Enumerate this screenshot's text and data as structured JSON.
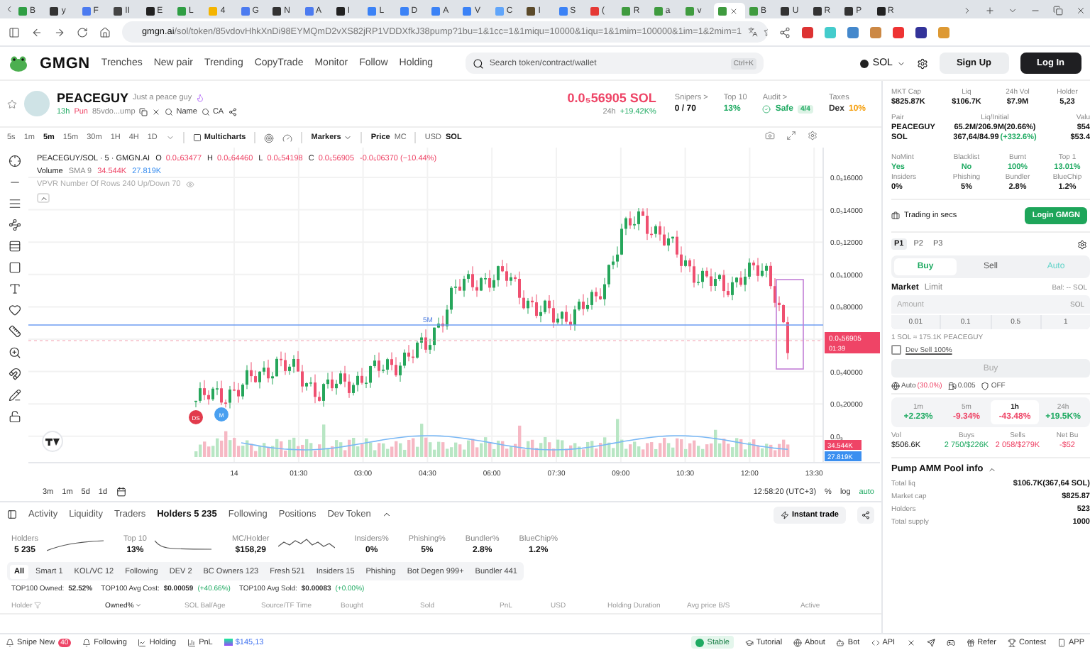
{
  "browser": {
    "tabs": [
      {
        "label": "B",
        "color": "#2f9e44",
        "selected": false
      },
      {
        "label": "y",
        "color": "#333333",
        "selected": false
      },
      {
        "label": "F",
        "color": "#4c7bf0",
        "selected": false
      },
      {
        "label": "II",
        "color": "#444444",
        "selected": false
      },
      {
        "label": "E",
        "color": "#222222",
        "selected": false
      },
      {
        "label": "L",
        "color": "#2f9e44",
        "selected": false
      },
      {
        "label": "4",
        "color": "#f4b400",
        "selected": false
      },
      {
        "label": "G",
        "color": "#4c7bf0",
        "selected": false
      },
      {
        "label": "N",
        "color": "#333333",
        "selected": false
      },
      {
        "label": "A",
        "color": "#4c7bf0",
        "selected": false
      },
      {
        "label": "I",
        "color": "#222222",
        "selected": false
      },
      {
        "label": "L",
        "color": "#3b82f6",
        "selected": false
      },
      {
        "label": "D",
        "color": "#3b82f6",
        "selected": false
      },
      {
        "label": "A",
        "color": "#3b82f6",
        "selected": false
      },
      {
        "label": "V",
        "color": "#3b82f6",
        "selected": false
      },
      {
        "label": "C",
        "color": "#60a5fa",
        "selected": false
      },
      {
        "label": "I",
        "color": "#5b4a2a",
        "selected": false
      },
      {
        "label": "S",
        "color": "#3b82f6",
        "selected": false
      },
      {
        "label": "(",
        "color": "#e53935",
        "selected": false
      },
      {
        "label": "R",
        "color": "#3f9b3f",
        "selected": false
      },
      {
        "label": "a",
        "color": "#3f9b3f",
        "selected": false
      },
      {
        "label": "v",
        "color": "#3f9b3f",
        "selected": false
      },
      {
        "color": "#3f9b3f",
        "selected": true
      },
      {
        "label": "B",
        "color": "#3f9b3f",
        "selected": false
      },
      {
        "label": "U",
        "color": "#333333",
        "selected": false
      },
      {
        "label": "R",
        "color": "#333333",
        "selected": false
      },
      {
        "label": "P",
        "color": "#333333",
        "selected": false
      },
      {
        "label": "R",
        "color": "#222222",
        "selected": false
      }
    ],
    "url_host": "gmgn.ai",
    "url_path": "/sol/token/85vdovHhkXnDi98EYMQmD2vXS82jRP1VDDXfkJ38pump?1bu=1&1cc=1&1miqu=10000&1iqu=1&1mim=100000&1im=1&2mim=1"
  },
  "header": {
    "logo": "GMGN",
    "nav": [
      "Trenches",
      "New pair",
      "Trending",
      "CopyTrade",
      "Monitor",
      "Follow",
      "Holding"
    ],
    "search": {
      "placeholder": "Search token/contract/wallet",
      "shortcut": "Ctrl+K"
    },
    "chain": "SOL",
    "sign_up": "Sign Up",
    "log_in": "Log In"
  },
  "token": {
    "name": "PEACEGUY",
    "tagline": "Just a peace guy",
    "age": "13h",
    "platform": "Pun",
    "address": "85vdo...ump",
    "links": [
      "Name",
      "CA"
    ],
    "price": "0.0₅56905 SOL",
    "change_label": "24h",
    "change": "+19.42K%",
    "stats": [
      {
        "label": "Snipers >",
        "value": "0 / 70",
        "color": "#111111"
      },
      {
        "label": "Top 10",
        "value": "13%",
        "color": "#1faa62"
      },
      {
        "label": "Audit >",
        "value": "Safe",
        "badge": "4/4",
        "color": "#1faa62"
      },
      {
        "label": "Taxes",
        "prefix": "Dex",
        "value": "10%",
        "color": "#f59e0b"
      }
    ]
  },
  "chart": {
    "intervals": [
      {
        "label": "5s",
        "selected": false
      },
      {
        "label": "1m",
        "selected": false
      },
      {
        "label": "5m",
        "selected": true
      },
      {
        "label": "15m",
        "selected": false
      },
      {
        "label": "30m",
        "selected": false
      },
      {
        "label": "1H",
        "selected": false
      },
      {
        "label": "4H",
        "selected": false
      },
      {
        "label": "1D",
        "selected": false
      }
    ],
    "multicharts": "Multicharts",
    "markers": "Markers",
    "price_mode": [
      {
        "label": "Price",
        "selected": true
      },
      {
        "label": "MC",
        "selected": false
      }
    ],
    "currency_mode": [
      {
        "label": "USD",
        "selected": false
      },
      {
        "label": "SOL",
        "selected": true
      }
    ],
    "symbol": "PEACEGUY/SOL · 5 · GMGN.AI",
    "ohlc": [
      {
        "label": "O",
        "value": "0.0₅63477"
      },
      {
        "label": "H",
        "value": "0.0₅64460"
      },
      {
        "label": "L",
        "value": "0.0₅54198"
      },
      {
        "label": "C",
        "value": "0.0₅56905"
      }
    ],
    "change": "-0.0₅06370 (−10.44%)",
    "volume_label": "Volume",
    "sma_label": "SMA 9",
    "legend_volume": [
      "34.544K",
      "27.819K"
    ],
    "axis_volume": [
      "34.544K",
      "27.819K"
    ],
    "vpvr": "VPVR Number Of Rows 240 Up/Down 70",
    "price_ticks": [
      "0.0₅16000",
      "0.0₅14000",
      "0.0₅12000",
      "0.0₅10000",
      "0.0₅80000",
      "0.0₅40000",
      "0.0₅20000",
      "0.0₅"
    ],
    "last_price": "0.0₅56905",
    "countdown": "01:39",
    "time_ticks": [
      "14",
      "01:30",
      "03:00",
      "04:30",
      "06:00",
      "07:30",
      "09:00",
      "10:30",
      "12:00",
      "13:30"
    ],
    "line_label": "5M",
    "badges": [
      "DS",
      "M"
    ],
    "ranges": [
      "3m",
      "1m",
      "5d",
      "1d"
    ],
    "clock": "12:58:20 (UTC+3)",
    "scale_options": [
      {
        "label": "%",
        "selected": false
      },
      {
        "label": "log",
        "selected": false
      },
      {
        "label": "auto",
        "selected": true
      }
    ]
  },
  "bottom": {
    "tabs": [
      {
        "label": "Activity",
        "selected": false
      },
      {
        "label": "Liquidity",
        "selected": false
      },
      {
        "label": "Traders",
        "selected": false
      },
      {
        "label": "Holders 5 235",
        "selected": true
      },
      {
        "label": "Following",
        "selected": false
      },
      {
        "label": "Positions",
        "selected": false
      },
      {
        "label": "Dev Token",
        "selected": false
      }
    ],
    "instant_trade": "Instant trade",
    "stats": [
      {
        "label": "Holders",
        "value": "5 235",
        "kind": "sparkline"
      },
      {
        "label": "Top 10",
        "value": "13%",
        "kind": "sparkline"
      },
      {
        "label": "MC/Holder",
        "value": "$158,29",
        "kind": "sparkline"
      },
      {
        "label": "Insiders%",
        "value": "0%",
        "kind": "plain"
      },
      {
        "label": "Phishing%",
        "value": "5%",
        "kind": "plain"
      },
      {
        "label": "Bundler%",
        "value": "2.8%",
        "kind": "plain"
      },
      {
        "label": "BlueChip%",
        "value": "1.2%",
        "kind": "plain"
      }
    ],
    "filters": [
      {
        "label": "All",
        "selected": true
      },
      {
        "label": "Smart 1",
        "selected": false
      },
      {
        "label": "KOL/VC 12",
        "selected": false
      },
      {
        "label": "Following",
        "selected": false
      },
      {
        "label": "DEV 2",
        "selected": false
      },
      {
        "label": "BC Owners 123",
        "selected": false
      },
      {
        "label": "Fresh 521",
        "selected": false
      },
      {
        "label": "Insiders 15",
        "selected": false
      },
      {
        "label": "Phishing",
        "selected": false
      },
      {
        "label": "Bot Degen 999+",
        "selected": false
      },
      {
        "label": "Bundler 441",
        "selected": false
      }
    ],
    "summary": [
      {
        "label": "TOP100 Owned:",
        "value": "52.52%"
      },
      {
        "label": "TOP100 Avg Cost:",
        "value": "$0.00059",
        "change": "(+40.66%)"
      },
      {
        "label": "TOP100 Avg Sold:",
        "value": "$0.00083",
        "change": "(+0.00%)"
      }
    ],
    "columns": [
      "Holder",
      "Owned%",
      "SOL Bal/Age",
      "Source/TF Time",
      "Bought",
      "Sold",
      "PnL",
      "USD",
      "Holding Duration",
      "Avg price B/S",
      "Active"
    ]
  },
  "status_bar": {
    "left": [
      {
        "label": "Snipe New",
        "badge": "40"
      },
      {
        "label": "Following"
      },
      {
        "label": "Holding"
      },
      {
        "label": "PnL"
      },
      {
        "label": "$145,13"
      }
    ],
    "right": [
      "Stable",
      "Tutorial",
      "About",
      "Bot",
      "API",
      "Refer",
      "Contest",
      "APP"
    ]
  },
  "panel": {
    "metrics": [
      {
        "label": "MKT Cap",
        "value": "$825.87K"
      },
      {
        "label": "Liq",
        "value": "$106.7K"
      },
      {
        "label": "24h Vol",
        "value": "$7.9M"
      },
      {
        "label": "Holder",
        "value": "5,23"
      }
    ],
    "pair": {
      "label": "Pair",
      "lines": [
        "PEACEGUY",
        "SOL"
      ]
    },
    "liq_initial": {
      "label": "Liq/Initial",
      "lines": [
        {
          "value": "65.2M/206.9M(20.66%)"
        },
        {
          "value": "367,64/84.99",
          "change": "(+332.6%)"
        }
      ]
    },
    "value": {
      "label": "Valu",
      "lines": [
        "$54",
        "$53.4"
      ]
    },
    "audit": [
      {
        "label": "NoMint",
        "value": "Yes",
        "color": "#1faa62"
      },
      {
        "label": "Blacklist",
        "value": "No",
        "color": "#1faa62"
      },
      {
        "label": "Burnt",
        "value": "100%",
        "color": "#1faa62"
      },
      {
        "label": "Top 1",
        "value": "13.01%",
        "color": "#1faa62"
      }
    ],
    "audit2": [
      {
        "label": "Insiders",
        "value": "0%",
        "color": "#111111"
      },
      {
        "label": "Phishing",
        "value": "5%",
        "color": "#111111"
      },
      {
        "label": "Bundler",
        "value": "2.8%",
        "color": "#111111"
      },
      {
        "label": "BlueChip",
        "value": "1.2%",
        "color": "#111111"
      }
    ],
    "trading_promo": "Trading in secs",
    "login": "Login GMGN",
    "presets": [
      {
        "label": "P1",
        "selected": true
      },
      {
        "label": "P2",
        "selected": false
      },
      {
        "label": "P3",
        "selected": false
      }
    ],
    "sides": [
      {
        "label": "Buy",
        "selected": true
      },
      {
        "label": "Sell",
        "selected": false
      },
      {
        "label": "Auto",
        "selected": false
      }
    ],
    "order_types": [
      {
        "label": "Market",
        "selected": true
      },
      {
        "label": "Limit",
        "selected": false
      }
    ],
    "balance": "Bal: -- SOL",
    "amount": {
      "placeholder": "Amount",
      "unit": "SOL"
    },
    "quick_amounts": [
      "0.01",
      "0.1",
      "0.5",
      "1"
    ],
    "conversion": "1 SOL ≈ 175.1K PEACEGUY",
    "dev_sell": {
      "label": "Dev Sell 100%",
      "checked": false
    },
    "buy_button": {
      "label": "Buy",
      "disabled": true
    },
    "settings": [
      {
        "label": "Auto",
        "value": "(30.0%)"
      },
      {
        "label": "0.005"
      },
      {
        "label": "OFF"
      }
    ],
    "periods": [
      {
        "label": "1m",
        "value": "+2.23%",
        "color": "#1faa62",
        "selected": false
      },
      {
        "label": "5m",
        "value": "-9.34%",
        "color": "#ee4466",
        "selected": false
      },
      {
        "label": "1h",
        "value": "-43.48%",
        "color": "#ee4466",
        "selected": true
      },
      {
        "label": "24h",
        "value": "+19.5K%",
        "color": "#1faa62",
        "selected": false
      }
    ],
    "flow": [
      {
        "label": "Vol",
        "value": "$506.6K",
        "color": "#111111"
      },
      {
        "label": "Buys",
        "value": "2 750/$226K",
        "color": "#1faa62"
      },
      {
        "label": "Sells",
        "value": "2 058/$279K",
        "color": "#ee4466"
      },
      {
        "label": "Net Bu",
        "value": "-$52",
        "color": "#ee4466"
      }
    ],
    "pool": {
      "title": "Pump AMM Pool info",
      "rows": [
        {
          "label": "Total liq",
          "value": "$106.7K(367,64 SOL)"
        },
        {
          "label": "Market cap",
          "value": "$825.87"
        },
        {
          "label": "Holders",
          "value": "523"
        },
        {
          "label": "Total supply",
          "value": "1000"
        }
      ]
    }
  }
}
